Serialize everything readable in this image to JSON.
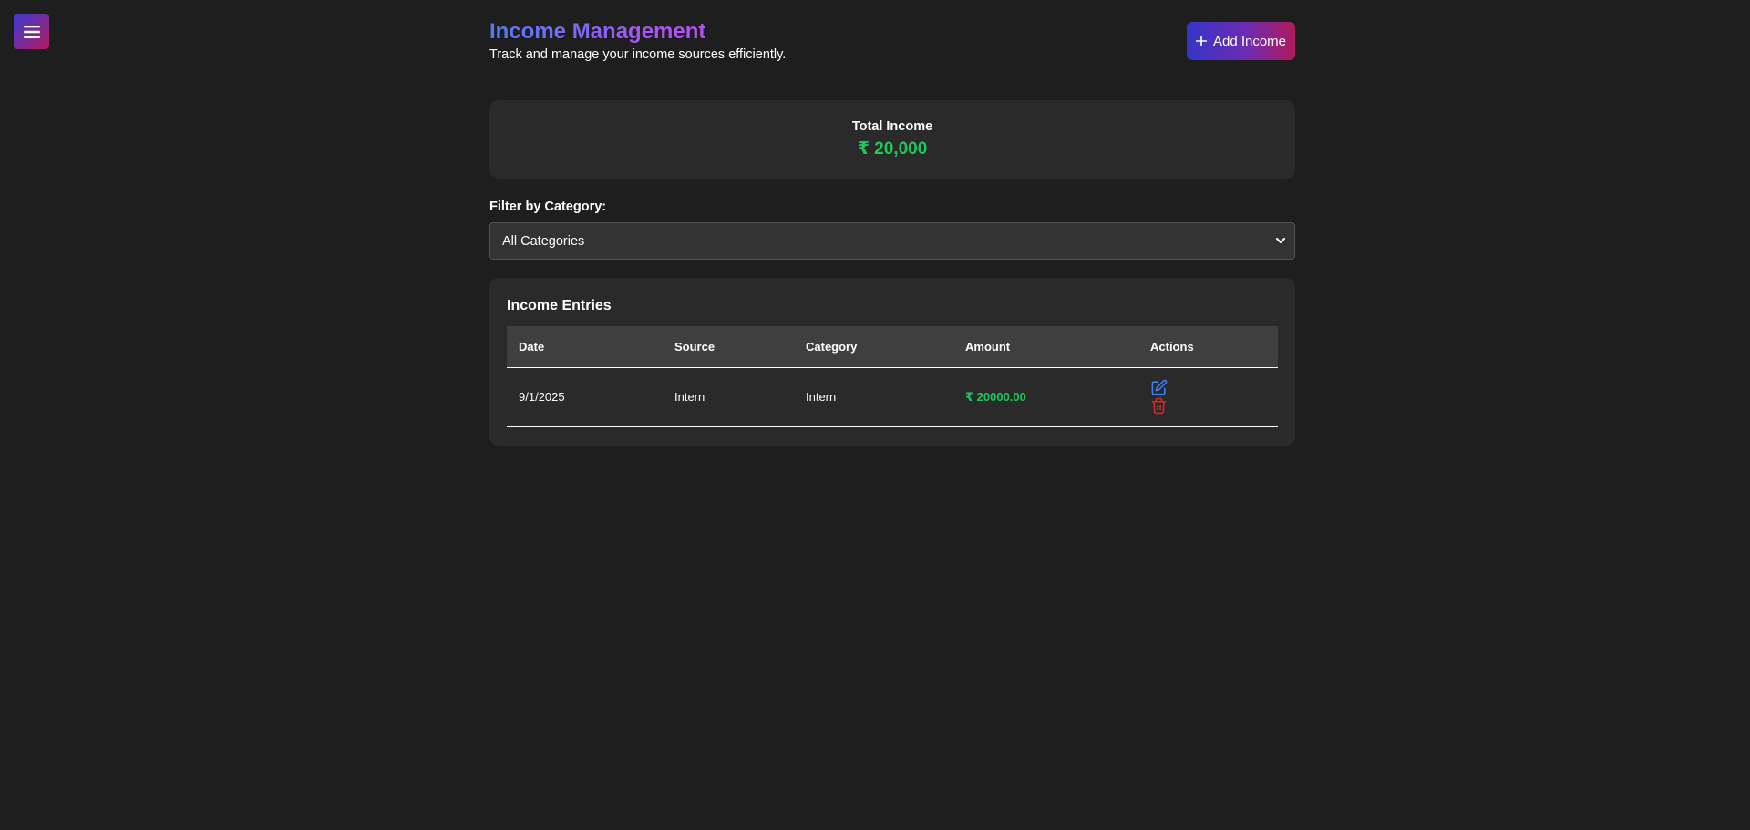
{
  "page": {
    "title": "Income Management",
    "subtitle": "Track and manage your income sources efficiently."
  },
  "header": {
    "add_button_label": "Add Income",
    "add_button_icon": "plus-icon",
    "menu_icon": "hamburger-menu-icon"
  },
  "summary": {
    "label": "Total Income",
    "value": "₹ 20,000"
  },
  "filter": {
    "label": "Filter by Category:",
    "selected": "All Categories"
  },
  "entries": {
    "title": "Income Entries",
    "columns": [
      "Date",
      "Source",
      "Category",
      "Amount",
      "Actions"
    ],
    "rows": [
      {
        "date": "9/1/2025",
        "source": "Intern",
        "category": "Intern",
        "amount": "₹ 20000.00"
      }
    ]
  },
  "colors": {
    "background": "#1e1e1e",
    "card": "#2a2a2a",
    "income_green": "#22c55e",
    "edit_blue": "#3b82f6",
    "delete_red": "#dc2626"
  }
}
